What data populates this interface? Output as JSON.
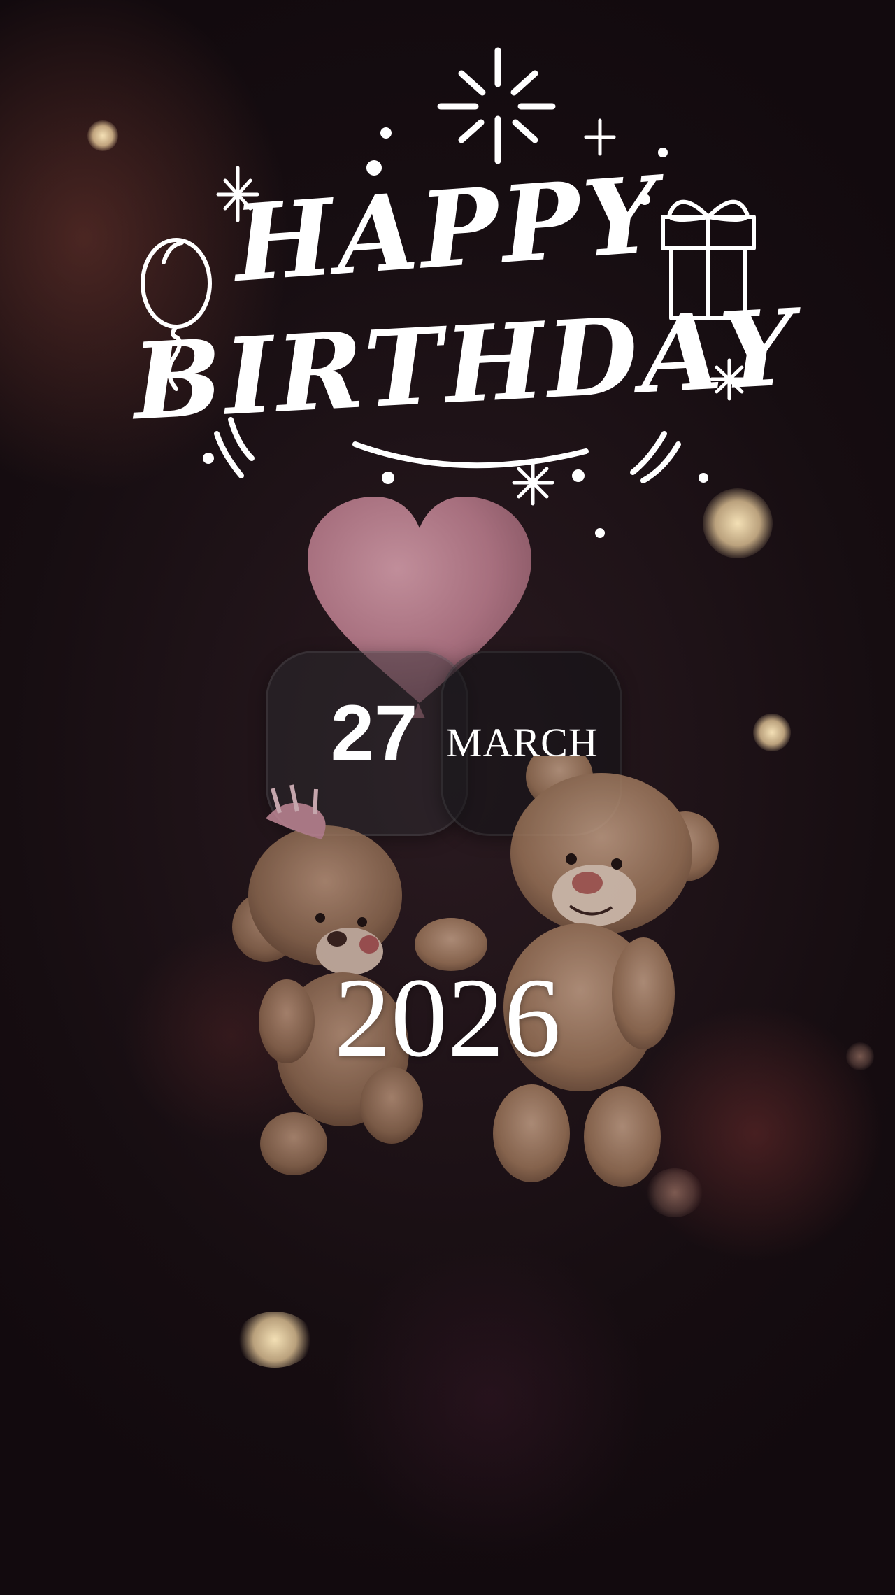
{
  "greeting": {
    "line1": "HAPPY",
    "line2": "BIRTHDAY"
  },
  "date_widget": {
    "day": "27",
    "month": "MARCH"
  },
  "year": "2026",
  "colors": {
    "background": "#1a1014",
    "text": "#ffffff",
    "heart": "#c98a99",
    "bokeh": "#f3dfb7"
  },
  "decorations": {
    "icons": [
      "sparkle-icon",
      "balloon-icon",
      "gift-icon",
      "heart-balloon-icon",
      "teddy-bears-illustration"
    ]
  }
}
